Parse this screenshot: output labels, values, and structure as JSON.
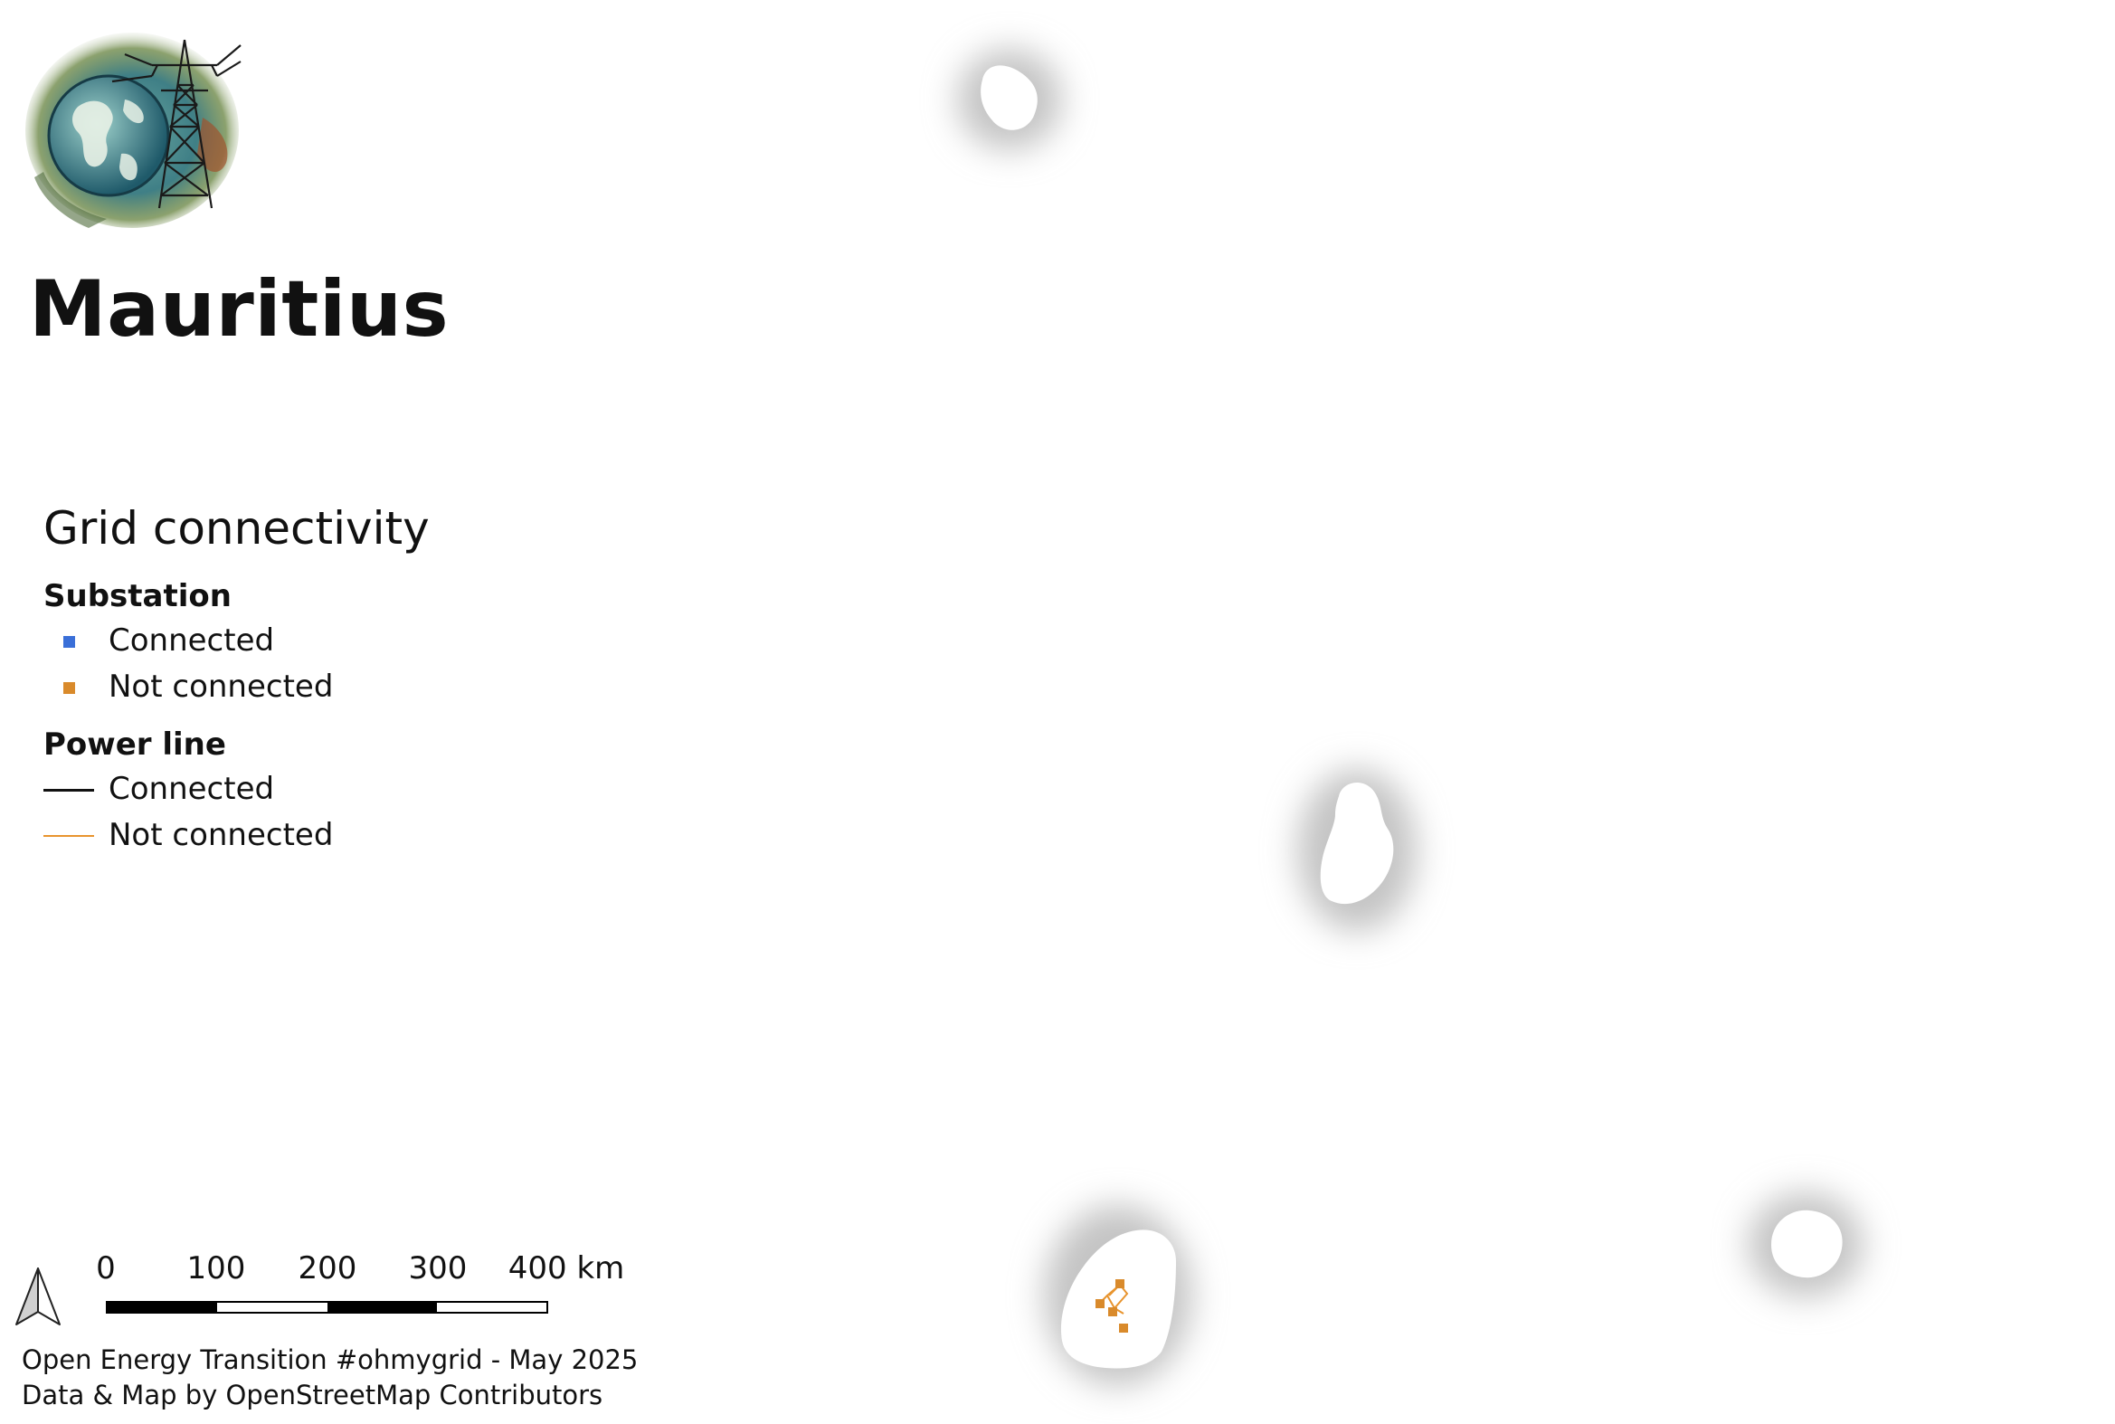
{
  "map": {
    "title": "Mauritius",
    "logo_icon": "globe-power-tower-logo-icon"
  },
  "legend": {
    "title": "Grid connectivity",
    "substation": {
      "heading": "Substation",
      "items": [
        {
          "label": "Connected",
          "color": "#3a6fd8",
          "symbol": "square"
        },
        {
          "label": "Not connected",
          "color": "#d98a2b",
          "symbol": "square"
        }
      ]
    },
    "power_line": {
      "heading": "Power line",
      "items": [
        {
          "label": "Connected",
          "color": "#111111",
          "symbol": "line"
        },
        {
          "label": "Not connected",
          "color": "#e8942e",
          "symbol": "line"
        }
      ]
    }
  },
  "scalebar": {
    "labels": [
      "0",
      "100",
      "200",
      "300",
      "400 km"
    ]
  },
  "north_arrow_icon": "north-arrow-icon",
  "credits": {
    "line1": "Open Energy Transition #ohmygrid - May 2025",
    "line2": "Data & Map by OpenStreetMap Contributors"
  },
  "colors": {
    "not_connected": "#d98a2b",
    "connected_substation": "#3a6fd8",
    "connected_line": "#111111",
    "island_fill": "#ffffff",
    "island_halo": "#bdbdbd"
  }
}
